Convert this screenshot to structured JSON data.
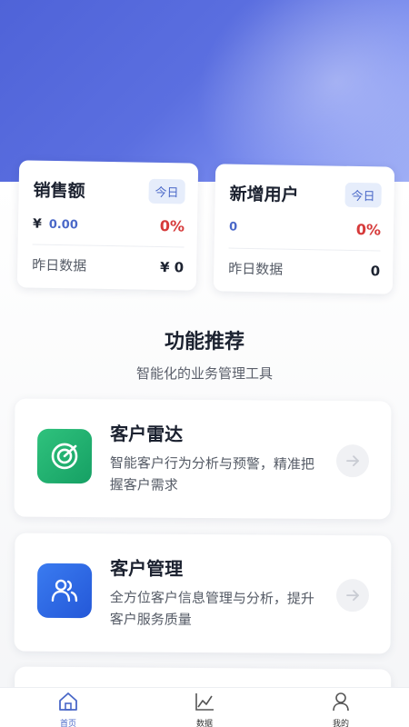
{
  "stats": [
    {
      "title": "销售额",
      "badge": "今日",
      "currency": "¥",
      "amount": "0.00",
      "percent": "0%",
      "yesterday_label": "昨日数据",
      "yesterday_value": "¥ 0"
    },
    {
      "title": "新增用户",
      "badge": "今日",
      "amount": "0",
      "percent": "0%",
      "yesterday_label": "昨日数据",
      "yesterday_value": "0"
    }
  ],
  "section": {
    "title": "功能推荐",
    "subtitle": "智能化的业务管理工具"
  },
  "features": [
    {
      "title": "客户雷达",
      "description": "智能客户行为分析与预警，精准把握客户需求",
      "icon": "radar-icon"
    },
    {
      "title": "客户管理",
      "description": "全方位客户信息管理与分析，提升客户服务质量",
      "icon": "users-icon"
    }
  ],
  "tabs": [
    {
      "label": "首页",
      "icon": "home-icon",
      "active": true
    },
    {
      "label": "数据",
      "icon": "chart-icon",
      "active": false
    },
    {
      "label": "我的",
      "icon": "person-icon",
      "active": false
    }
  ],
  "colors": {
    "accent": "#4a68c8",
    "danger": "#d63a3a",
    "green": "#1faf6e",
    "blue": "#2f66e4"
  }
}
